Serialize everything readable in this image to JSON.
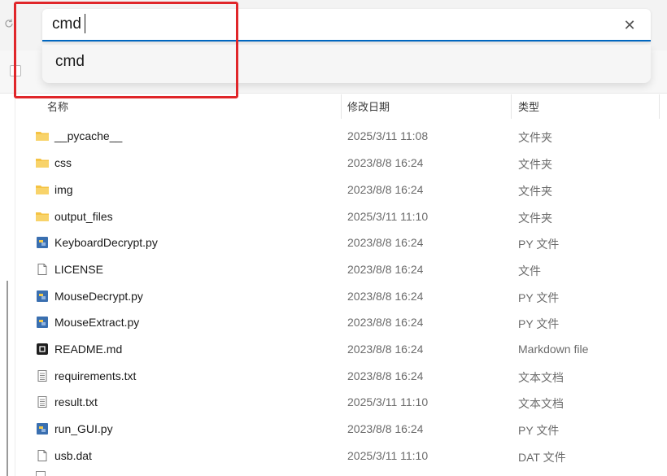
{
  "address_bar": {
    "value": "cmd",
    "clear_icon": "✕"
  },
  "suggestions": [
    {
      "label": "cmd"
    }
  ],
  "columns": {
    "name": "名称",
    "date": "修改日期",
    "type": "类型"
  },
  "files": [
    {
      "name": "__pycache__",
      "date": "2025/3/11 11:08",
      "type": "文件夹",
      "icon": "folder-icon"
    },
    {
      "name": "css",
      "date": "2023/8/8 16:24",
      "type": "文件夹",
      "icon": "folder-icon"
    },
    {
      "name": "img",
      "date": "2023/8/8 16:24",
      "type": "文件夹",
      "icon": "folder-icon"
    },
    {
      "name": "output_files",
      "date": "2025/3/11 11:10",
      "type": "文件夹",
      "icon": "folder-icon"
    },
    {
      "name": "KeyboardDecrypt.py",
      "date": "2023/8/8 16:24",
      "type": "PY 文件",
      "icon": "python-file-icon"
    },
    {
      "name": "LICENSE",
      "date": "2023/8/8 16:24",
      "type": "文件",
      "icon": "blank-file-icon"
    },
    {
      "name": "MouseDecrypt.py",
      "date": "2023/8/8 16:24",
      "type": "PY 文件",
      "icon": "python-file-icon"
    },
    {
      "name": "MouseExtract.py",
      "date": "2023/8/8 16:24",
      "type": "PY 文件",
      "icon": "python-file-icon"
    },
    {
      "name": "README.md",
      "date": "2023/8/8 16:24",
      "type": "Markdown file",
      "icon": "markdown-file-icon"
    },
    {
      "name": "requirements.txt",
      "date": "2023/8/8 16:24",
      "type": "文本文档",
      "icon": "text-file-icon"
    },
    {
      "name": "result.txt",
      "date": "2025/3/11 11:10",
      "type": "文本文档",
      "icon": "text-file-icon"
    },
    {
      "name": "run_GUI.py",
      "date": "2023/8/8 16:24",
      "type": "PY 文件",
      "icon": "python-file-icon"
    },
    {
      "name": "usb.dat",
      "date": "2025/3/11 11:10",
      "type": "DAT 文件",
      "icon": "blank-file-icon"
    }
  ],
  "colors": {
    "accent": "#0067c0",
    "highlight": "#e0262a",
    "folder": "#f5c343",
    "python_blue": "#3a6fb0",
    "python_yellow": "#f2c94c"
  }
}
